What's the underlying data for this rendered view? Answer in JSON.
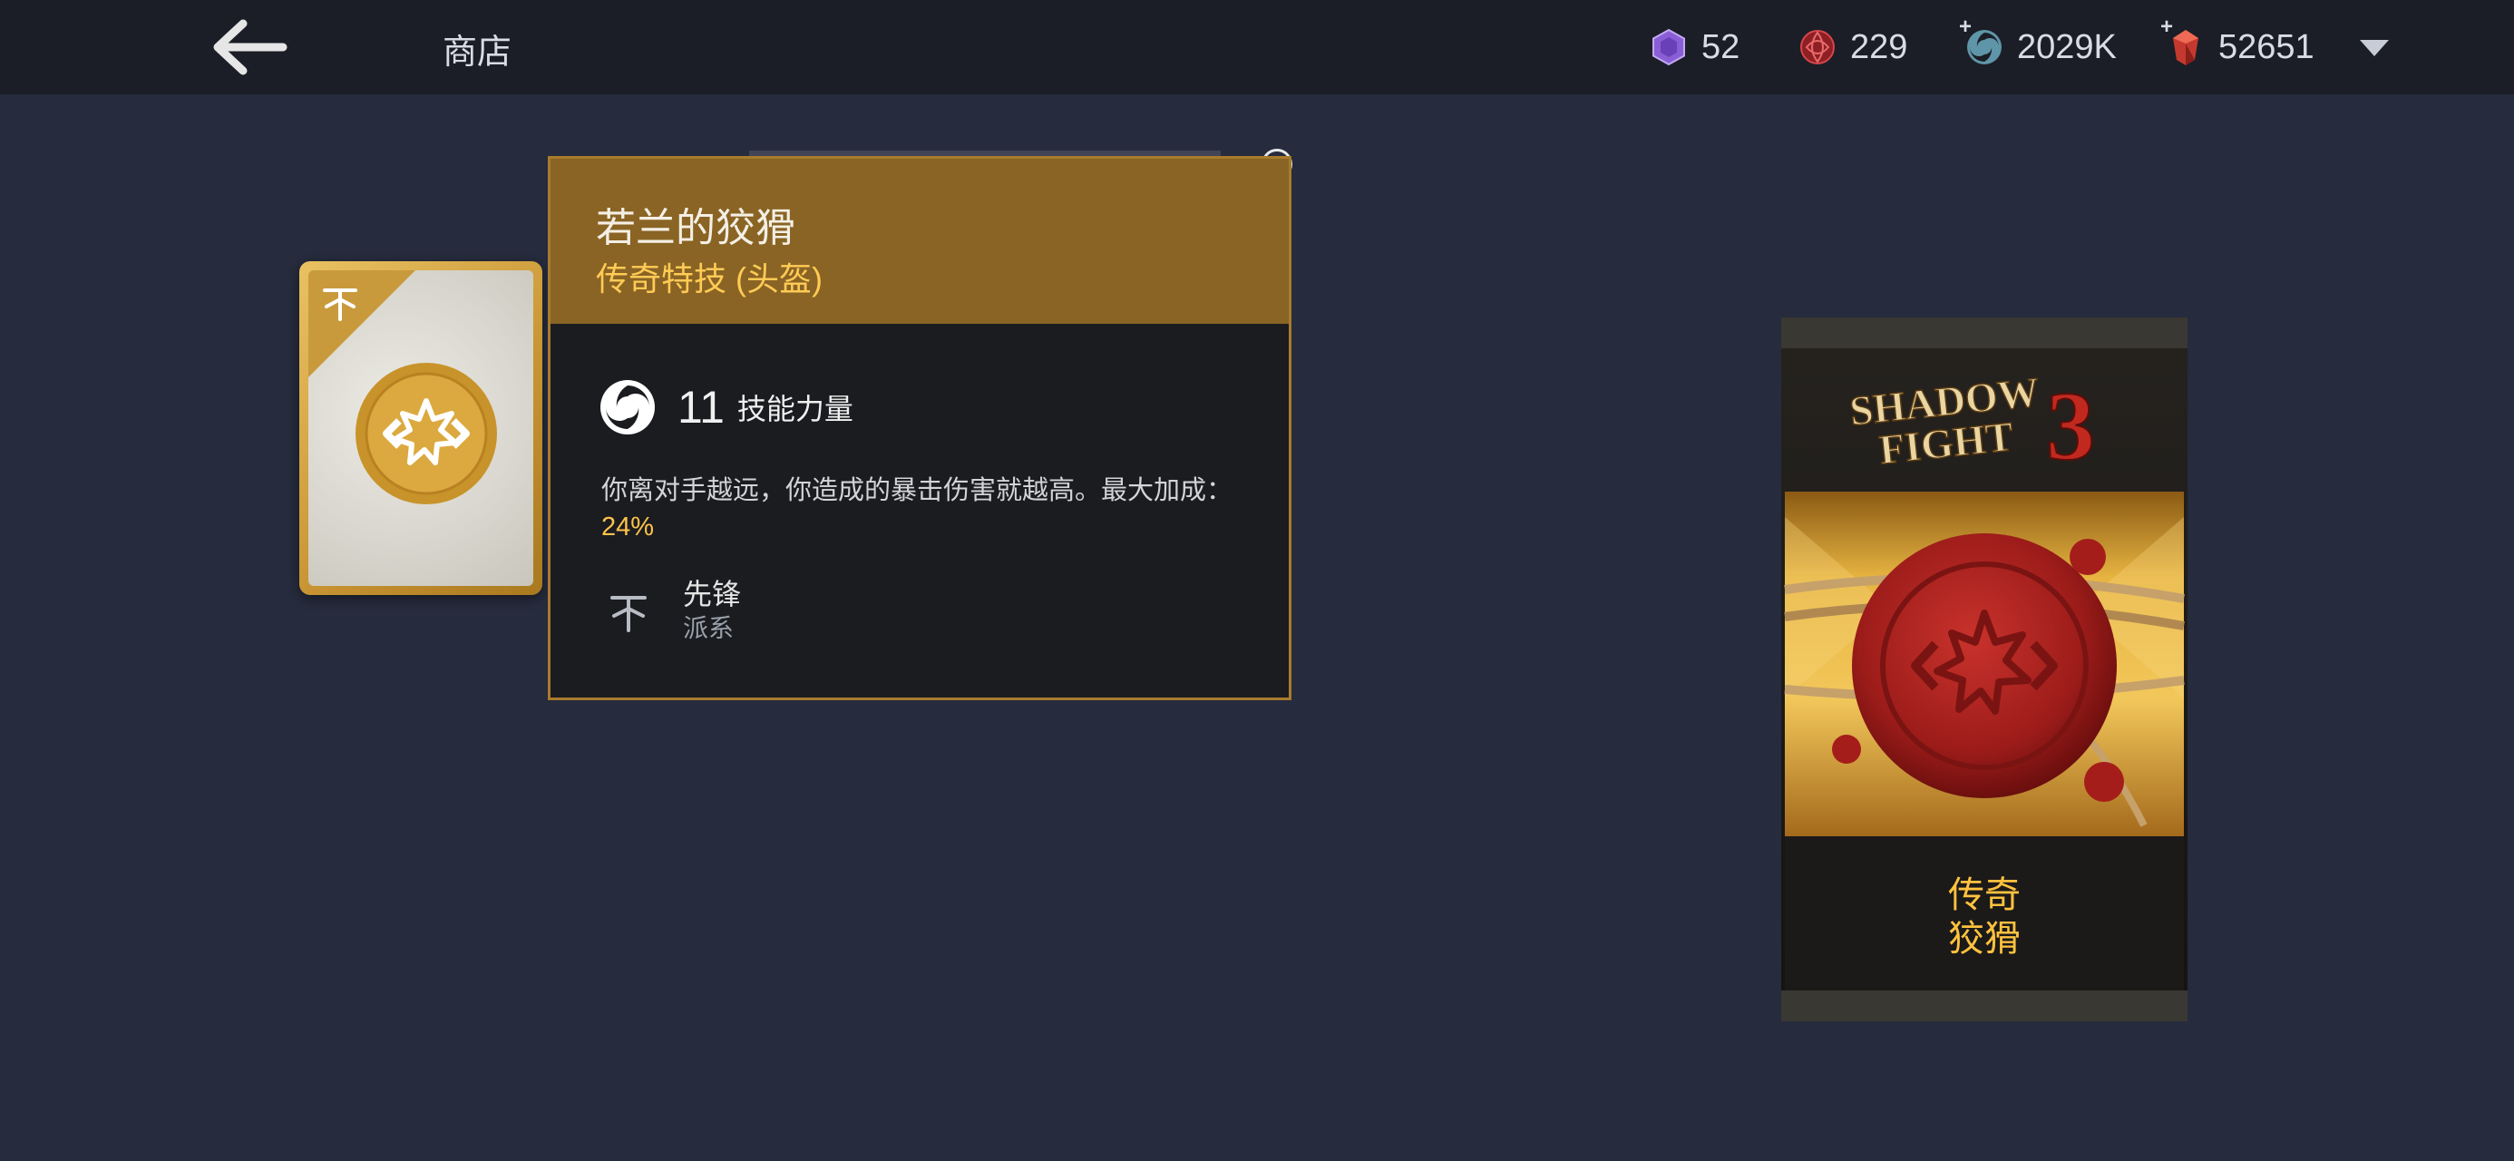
{
  "topbar": {
    "title": "商店",
    "currencies": [
      {
        "name": "hex-gem",
        "value": "52",
        "color": "#9a6de0"
      },
      {
        "name": "orb",
        "value": "229",
        "color": "#c23a3a"
      },
      {
        "name": "swirl-coin",
        "value": "2029K",
        "color": "#7fb6c8"
      },
      {
        "name": "ruby",
        "value": "52651",
        "color": "#d8483a"
      }
    ]
  },
  "popup": {
    "title": "若兰的狡猾",
    "subtitle": "传奇特技 (头盔)",
    "stat": {
      "value": "11",
      "label": "技能力量"
    },
    "description_prefix": "你离对手越远，你造成的暴击伤害就越高。最大加成：",
    "description_value": "24%",
    "faction": {
      "name": "先锋",
      "label": "派系"
    }
  },
  "pack": {
    "logo": "SHADOW FIGHT 3",
    "label_line1": "传奇",
    "label_line2": "狡猾"
  },
  "colors": {
    "background": "#262b3d",
    "topbar": "#1b1e26",
    "gold": "#8a6424",
    "accent": "#ffc24a"
  }
}
